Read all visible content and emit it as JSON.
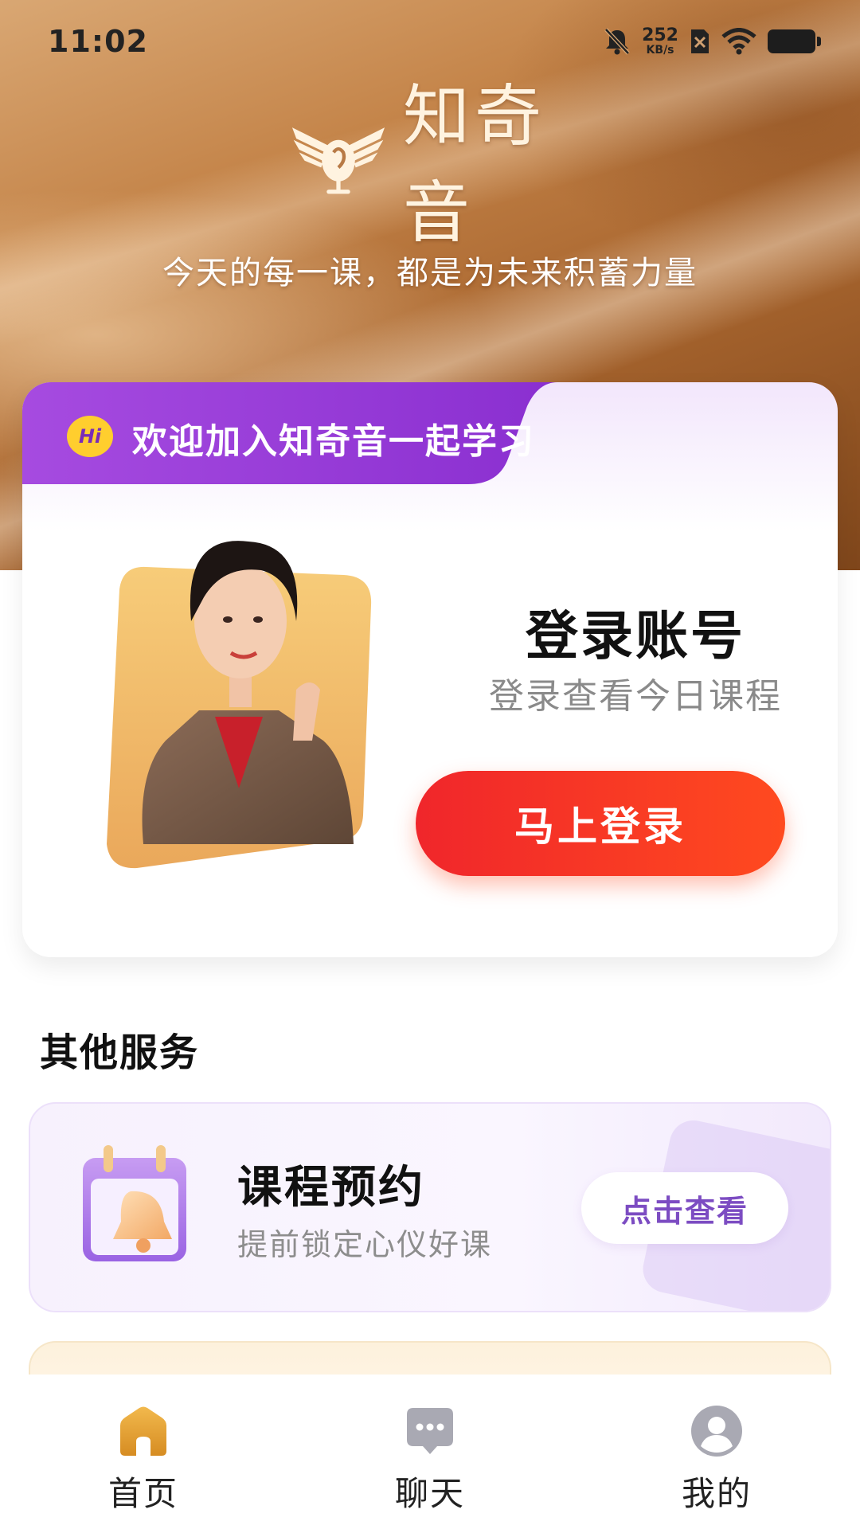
{
  "status_bar": {
    "time": "11:02",
    "net_speed_value": "252",
    "net_speed_unit": "KB/s"
  },
  "hero": {
    "logo_text": "知奇音",
    "slogan": "今天的每一课，都是为未来积蓄力量"
  },
  "login_card": {
    "hi_badge": "Hi",
    "welcome": "欢迎加入知奇音一起学习",
    "title": "登录账号",
    "subtitle": "登录查看今日课程",
    "button": "马上登录"
  },
  "services": {
    "section_title": "其他服务",
    "items": [
      {
        "title": "课程预约",
        "subtitle": "提前锁定心仪好课",
        "button": "点击查看",
        "icon": "calendar-bell-icon"
      }
    ]
  },
  "bottom_nav": {
    "items": [
      {
        "label": "首页",
        "icon": "home-icon",
        "active": true
      },
      {
        "label": "聊天",
        "icon": "chat-icon",
        "active": false
      },
      {
        "label": "我的",
        "icon": "user-icon",
        "active": false
      }
    ]
  },
  "colors": {
    "primary_red": "#f0262b",
    "welcome_purple": "#9b3fd6",
    "service_accent": "#7c4cc2",
    "nav_active": "#e0a43a",
    "nav_inactive": "#a9a9b3"
  }
}
